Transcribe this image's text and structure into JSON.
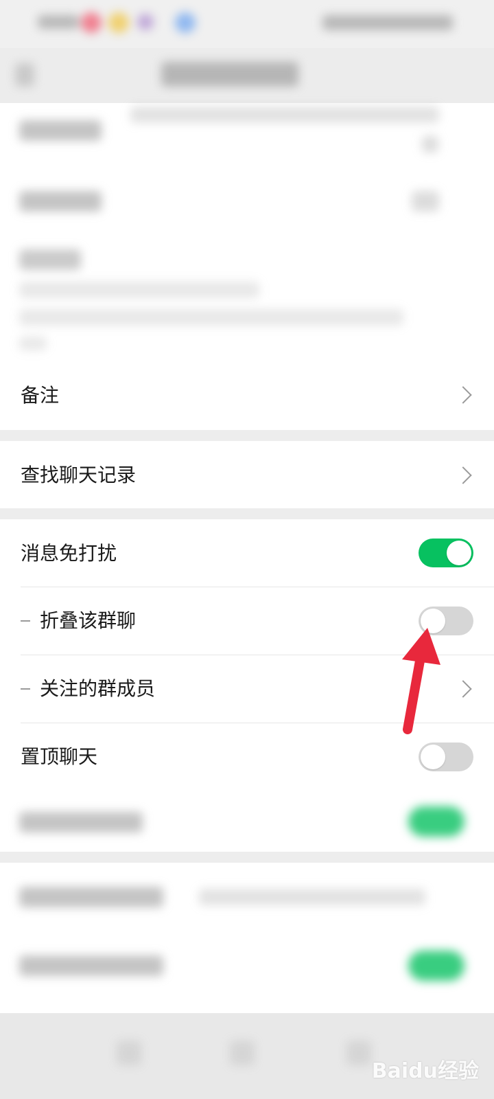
{
  "settings": {
    "remark_label": "备注",
    "search_history_label": "查找聊天记录",
    "mute_label": "消息免打扰",
    "mute_on": true,
    "fold_label": "折叠该群聊",
    "fold_on": false,
    "followed_members_label": "关注的群成员",
    "pin_label": "置顶聊天",
    "pin_on": false
  },
  "watermark": "Baidu经验",
  "colors": {
    "toggle_on": "#07c160",
    "toggle_off": "#d6d6d6",
    "annotation_arrow": "#e8283c",
    "page_background": "#ededed"
  },
  "icons": [
    "chevron-right-icon",
    "annotation-arrow-icon"
  ]
}
